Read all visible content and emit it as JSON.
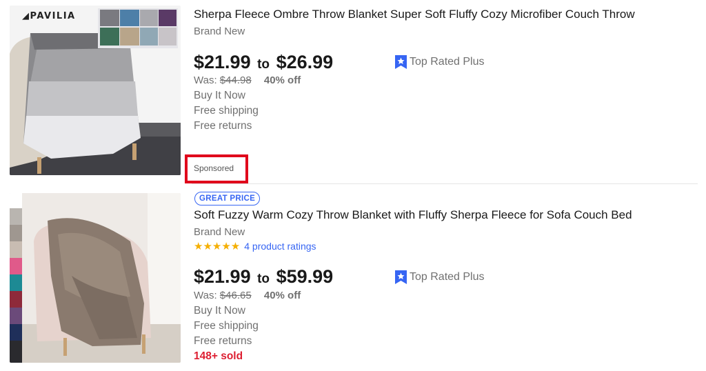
{
  "listings": [
    {
      "brand_logo": "PAVILIA",
      "title": "Sherpa Fleece Ombre Throw Blanket Super Soft Fluffy Cozy Microfiber Couch Throw",
      "condition": "Brand New",
      "price_low": "$21.99",
      "price_to": "to",
      "price_high": "$26.99",
      "was_label": "Was:",
      "was_price": "$44.98",
      "discount": "40% off",
      "buy_format": "Buy It Now",
      "shipping": "Free shipping",
      "returns": "Free returns",
      "top_rated": "Top Rated Plus",
      "sponsored": "Sponsored"
    },
    {
      "badge": "GREAT PRICE",
      "title": "Soft Fuzzy Warm Cozy Throw Blanket with Fluffy Sherpa Fleece for Sofa Couch Bed",
      "condition": "Brand New",
      "stars": "★★★★★",
      "ratings": "4 product ratings",
      "price_low": "$21.99",
      "price_to": "to",
      "price_high": "$59.99",
      "was_label": "Was:",
      "was_price": "$46.65",
      "discount": "40% off",
      "buy_format": "Buy It Now",
      "shipping": "Free shipping",
      "returns": "Free returns",
      "sold": "148+ sold",
      "top_rated": "Top Rated Plus"
    }
  ],
  "colors": {
    "link_blue": "#3665f3",
    "sold_red": "#dd1e31",
    "highlight_red": "#e0001b",
    "star_gold": "#f5af02"
  }
}
